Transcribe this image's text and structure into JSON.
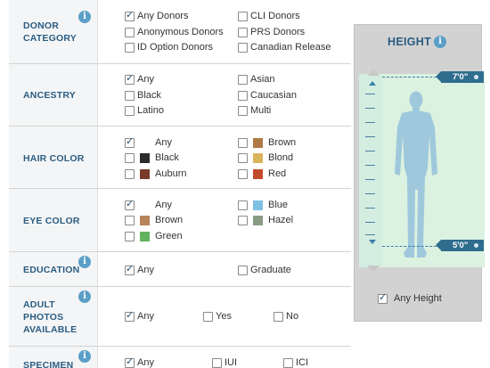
{
  "rows": [
    {
      "id": "donor-category",
      "label": "DONOR CATEGORY",
      "info": "i",
      "options": [
        {
          "label": "Any Donors",
          "checked": true
        },
        {
          "label": "Anonymous Donors",
          "checked": false
        },
        {
          "label": "ID Option Donors",
          "checked": false
        },
        {
          "label": "CLI Donors",
          "checked": false
        },
        {
          "label": "PRS Donors",
          "checked": false
        },
        {
          "label": "Canadian Release",
          "checked": false
        }
      ]
    },
    {
      "id": "ancestry",
      "label": "ANCESTRY",
      "options": [
        {
          "label": "Any",
          "checked": true
        },
        {
          "label": "Black",
          "checked": false
        },
        {
          "label": "Latino",
          "checked": false
        },
        {
          "label": "Asian",
          "checked": false
        },
        {
          "label": "Caucasian",
          "checked": false
        },
        {
          "label": "Multi",
          "checked": false
        }
      ]
    },
    {
      "id": "hair-color",
      "label": "HAIR COLOR",
      "options": [
        {
          "label": "Any",
          "checked": true,
          "swatch": null
        },
        {
          "label": "Black",
          "checked": false,
          "swatch": "#2b2b2b"
        },
        {
          "label": "Auburn",
          "checked": false,
          "swatch": "#7a3b2a"
        },
        {
          "label": "Brown",
          "checked": false,
          "swatch": "#b07a46"
        },
        {
          "label": "Blond",
          "checked": false,
          "swatch": "#d9b45a"
        },
        {
          "label": "Red",
          "checked": false,
          "swatch": "#c24a2c"
        }
      ]
    },
    {
      "id": "eye-color",
      "label": "EYE COLOR",
      "options": [
        {
          "label": "Any",
          "checked": true,
          "swatch": null
        },
        {
          "label": "Brown",
          "checked": false,
          "swatch": "#b8845a"
        },
        {
          "label": "Green",
          "checked": false,
          "swatch": "#62b25e"
        },
        {
          "label": "Blue",
          "checked": false,
          "swatch": "#7cc0e2"
        },
        {
          "label": "Hazel",
          "checked": false,
          "swatch": "#8a9b86"
        }
      ]
    },
    {
      "id": "education",
      "label": "EDUCATION",
      "info": "i",
      "options": [
        {
          "label": "Any",
          "checked": true
        },
        {
          "label": "Graduate",
          "checked": false
        }
      ]
    },
    {
      "id": "adult-photos",
      "label": "ADULT PHOTOS AVAILABLE",
      "label_lines": [
        "ADULT",
        "PHOTOS",
        "AVAILABLE"
      ],
      "info": "i",
      "options": [
        {
          "label": "Any",
          "checked": true
        },
        {
          "label": "Yes",
          "checked": false
        },
        {
          "label": "No",
          "checked": false
        }
      ]
    },
    {
      "id": "specimen",
      "label": "SPECIMEN",
      "info": "i",
      "options": [
        {
          "label": "Any",
          "checked": true
        },
        {
          "label": "IUI",
          "checked": false
        },
        {
          "label": "ICI",
          "checked": false
        }
      ]
    }
  ],
  "height": {
    "title": "HEIGHT",
    "info": "i",
    "max_label": "7'0\"",
    "min_label": "5'0\"",
    "any_label": "Any Height",
    "any_checked": true,
    "figure_color": "#9fc8dc"
  }
}
